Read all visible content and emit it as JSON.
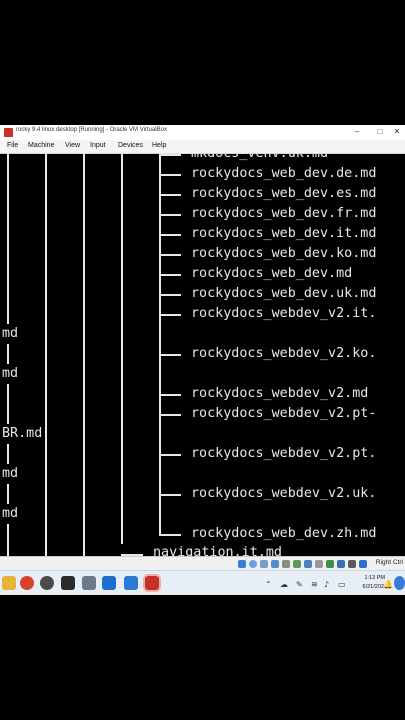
{
  "window": {
    "title": "rocky 9.4 linux desktop [Running] - Oracle VM VirtualBox"
  },
  "menu": {
    "items": [
      "File",
      "Machine",
      "View",
      "Input",
      "Devices",
      "Help"
    ]
  },
  "terminal": {
    "lines": [
      "mkdocs_venv.uk.md",
      "rockydocs_web_dev.de.md",
      "rockydocs_web_dev.es.md",
      "rockydocs_web_dev.fr.md",
      "rockydocs_web_dev.it.md",
      "rockydocs_web_dev.ko.md",
      "rockydocs_web_dev.md",
      "rockydocs_web_dev.uk.md",
      "rockydocs_webdev_v2.it.",
      "md",
      "rockydocs_webdev_v2.ko.",
      "md",
      "rockydocs_webdev_v2.md",
      "rockydocs_webdev_v2.pt-",
      "BR.md",
      "rockydocs_webdev_v2.pt.",
      "md",
      "rockydocs_webdev_v2.uk.",
      "md",
      "rockydocs_web_dev.zh.md",
      "navigation.it.md"
    ]
  },
  "statusbar": {
    "host_key": "Right Ctrl"
  },
  "taskbar": {
    "time": "1:13 PM",
    "date": "6/21/2024"
  },
  "colors": {
    "terminal_bg": "#000000",
    "terminal_fg": "#e8e8e8",
    "taskbar_bg": "#e8eef6"
  }
}
